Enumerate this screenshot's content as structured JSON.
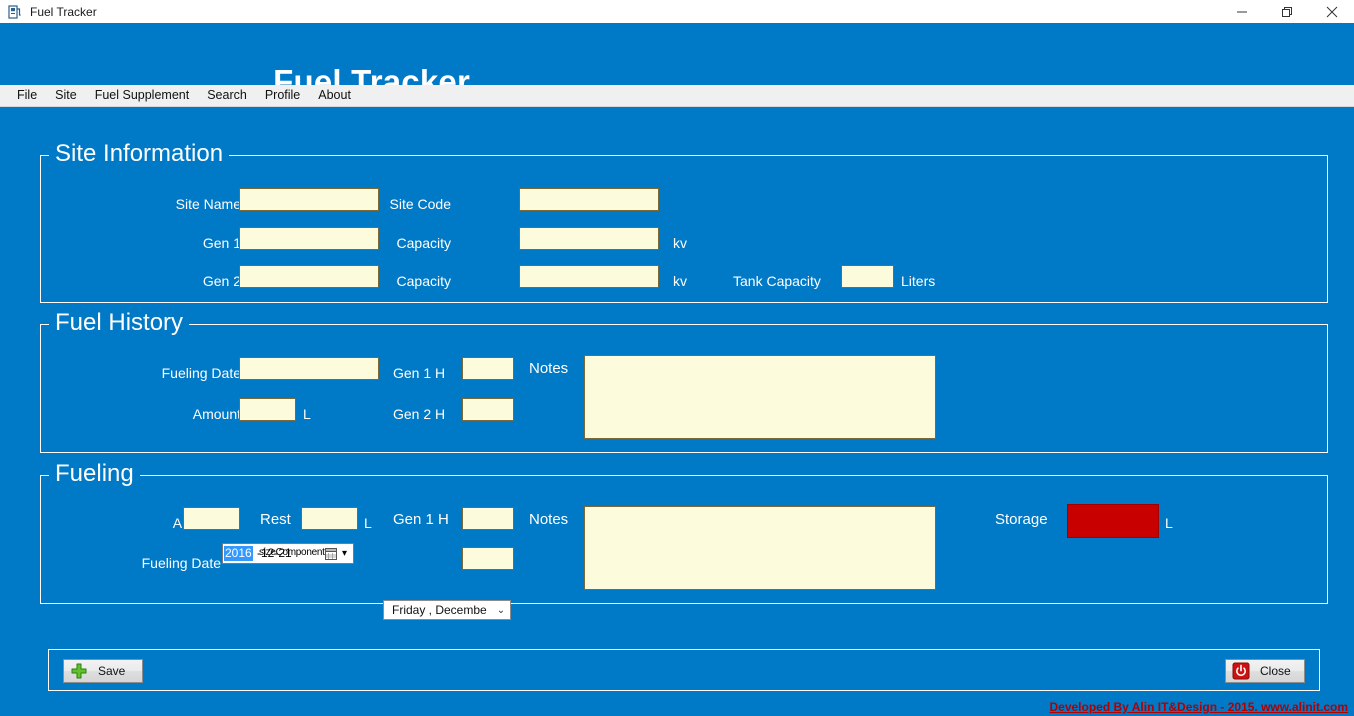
{
  "window": {
    "title": "Fuel Tracker",
    "icon": "fuel-pump-icon",
    "minimize": "—",
    "maximize": "❐",
    "close": "✕"
  },
  "header": {
    "title": "Fuel Tracker",
    "background": "#0079c6"
  },
  "menubar": {
    "items": [
      {
        "label": "File"
      },
      {
        "label": "Site"
      },
      {
        "label": "Fuel Supplement"
      },
      {
        "label": "Search"
      },
      {
        "label": "Profile"
      },
      {
        "label": "About"
      }
    ]
  },
  "site_information": {
    "title": "Site Information",
    "site_name_label": "Site Name",
    "site_name_value": "",
    "site_code_label": "Site Code",
    "site_code_value": "",
    "gen1_label": "Gen 1",
    "gen1_value": "",
    "capacity1_label": "Capacity",
    "capacity1_value": "",
    "capacity1_unit": "kv",
    "gen2_label": "Gen 2",
    "gen2_value": "",
    "capacity2_label": "Capacity",
    "capacity2_value": "",
    "capacity2_unit": "kv",
    "tank_capacity_label": "Tank Capacity",
    "tank_capacity_value": "",
    "tank_capacity_unit": "Liters"
  },
  "fuel_history": {
    "title": "Fuel History",
    "fueling_date_label": "Fueling Date",
    "fueling_date_value": "",
    "gen1h_label": "Gen 1 H",
    "gen1h_value": "",
    "notes_label": "Notes",
    "notes_value": "",
    "amount_label": "Amount",
    "amount_value": "",
    "amount_unit": "L",
    "gen2h_label": "Gen 2 H",
    "gen2h_value": ""
  },
  "fueling": {
    "title": "Fueling",
    "amount_label": "Amount",
    "amount_value": "",
    "rest_label": "Rest",
    "rest_value": "",
    "rest_unit": "L",
    "gen1h_label": "Gen 1 H",
    "gen1h_value": "",
    "notes_label": "Notes",
    "notes_value": "",
    "storage_label": "Storage",
    "storage_value": "",
    "storage_unit": "L",
    "storage_color": "#c80000",
    "fueling_date_label": "Fueling Date",
    "date_selected_part": "2016",
    "date_rest_part": "-12-21",
    "date_overlap_artifact": "sizeComponent",
    "date_calendar_icon": "calendar-icon",
    "date_spinner_icon": "spinner-updown-icon",
    "date_combo_value": "Friday    , Decembe",
    "date_combo_arrow": "⌄"
  },
  "buttons": {
    "save_label": "Save",
    "save_icon": "green-plus-icon",
    "close_label": "Close",
    "close_icon": "red-power-icon"
  },
  "footer": {
    "credit": "Developed By Alin IT&Design - 2015. www.alinit.com",
    "color": "#b00000"
  }
}
